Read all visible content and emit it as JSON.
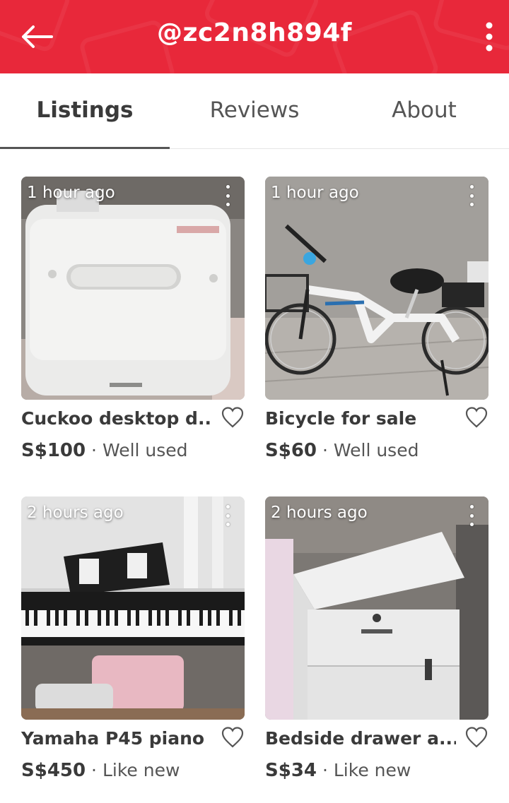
{
  "header": {
    "title": "@zc2n8h894f"
  },
  "tabs": [
    {
      "label": "Listings",
      "active": true
    },
    {
      "label": "Reviews",
      "active": false
    },
    {
      "label": "About",
      "active": false
    }
  ],
  "listings": [
    {
      "time": "1 hour ago",
      "title": "Cuckoo desktop d...",
      "price": "S$100",
      "separator": "·",
      "condition": "Well used",
      "icon": "dishwasher-photo"
    },
    {
      "time": "1 hour ago",
      "title": "Bicycle for sale",
      "price": "S$60",
      "separator": "·",
      "condition": "Well used",
      "icon": "bicycle-photo"
    },
    {
      "time": "2 hours ago",
      "title": "Yamaha P45 piano",
      "price": "S$450",
      "separator": "·",
      "condition": "Like new",
      "icon": "piano-photo"
    },
    {
      "time": "2 hours ago",
      "title": "Bedside drawer a...",
      "price": "S$34",
      "separator": "·",
      "condition": "Like new",
      "icon": "drawer-photo"
    }
  ],
  "colors": {
    "accent": "#e8283a",
    "text": "#3a3a3a"
  }
}
